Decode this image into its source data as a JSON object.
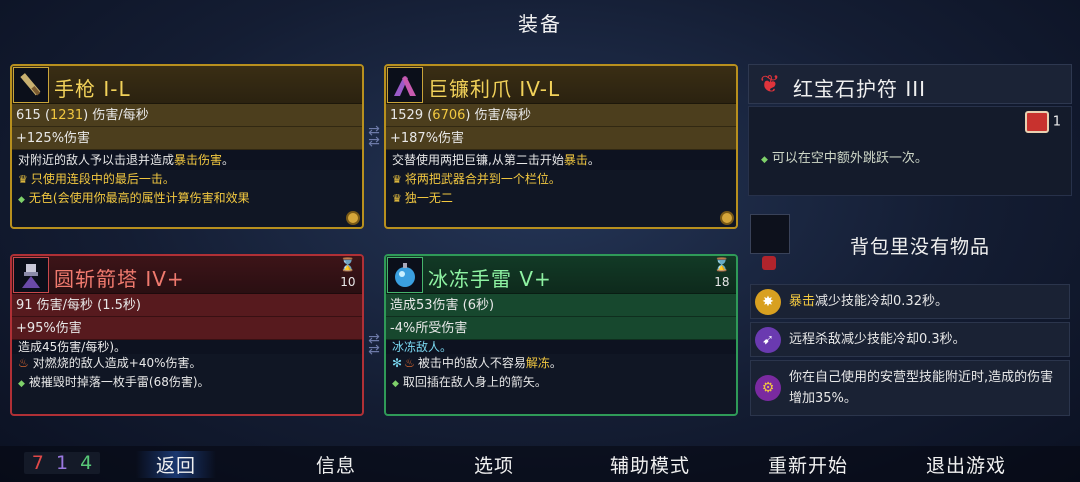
{
  "title": "装备",
  "cards": {
    "pistol": {
      "name": "手枪 I-L",
      "stat1_a": "615 (",
      "stat1_b": "1231",
      "stat1_c": ") 伤害/每秒",
      "stat2": "+125%伤害",
      "desc_a": "对附近的敌人予以击退并造成",
      "desc_hl": "暴击伤害",
      "desc_b": "。",
      "trait1": "只使用连段中的最后一击。",
      "trait2": "无色(会使用你最高的属性计算伤害和效果"
    },
    "scythe": {
      "name": "巨镰利爪 IV-L",
      "stat1_a": "1529 (",
      "stat1_b": "6706",
      "stat1_c": ") 伤害/每秒",
      "stat2": "+187%伤害",
      "desc_a": "交替使用两把巨镰,从第二击开始",
      "desc_hl": "暴击",
      "desc_b": "。",
      "trait1": "将两把武器合并到一个栏位。",
      "trait2": "独一无二"
    },
    "turret": {
      "name": "圆斩箭塔 IV+",
      "timer": "10",
      "stat1": "91 伤害/每秒 (1.5秒)",
      "stat2": "+95%伤害",
      "desc": "造成45伤害/每秒)。",
      "trait1": "对燃烧的敌人造成+40%伤害。",
      "trait2": "被摧毁时掉落一枚手雷(68伤害)。"
    },
    "grenade": {
      "name": "冰冻手雷 V+",
      "timer": "18",
      "stat1": "造成53伤害 (6秒)",
      "stat2": "-4%所受伤害",
      "desc": "冰冻敌人。",
      "trait1_a": "被击中的敌人不容易",
      "trait1_hl": "解冻",
      "trait1_b": "。",
      "trait2": "取回插在敌人身上的箭矢。"
    }
  },
  "amulet": {
    "name": "红宝石护符 III",
    "mutation_count": "1",
    "desc": "可以在空中额外跳跃一次。"
  },
  "backpack": {
    "empty_text": "背包里没有物品"
  },
  "mutations": [
    {
      "hl": "暴击",
      "text": "减少技能冷却0.32秒。"
    },
    {
      "hl": "",
      "text": "远程杀敌减少技能冷却0.3秒。"
    },
    {
      "hl": "",
      "text": "你在自己使用的安营型技能附近时,造成的伤害增加35%。"
    }
  ],
  "cells": {
    "red": "7",
    "purple": "1",
    "green": "4"
  },
  "nav": {
    "back": "返回",
    "info": "信息",
    "options": "选项",
    "assist": "辅助模式",
    "restart": "重新开始",
    "quit": "退出游戏"
  },
  "colors": {
    "gold": "#b8901e",
    "red": "#b03036",
    "green": "#2f9a58",
    "highlight": "#f2c840"
  }
}
